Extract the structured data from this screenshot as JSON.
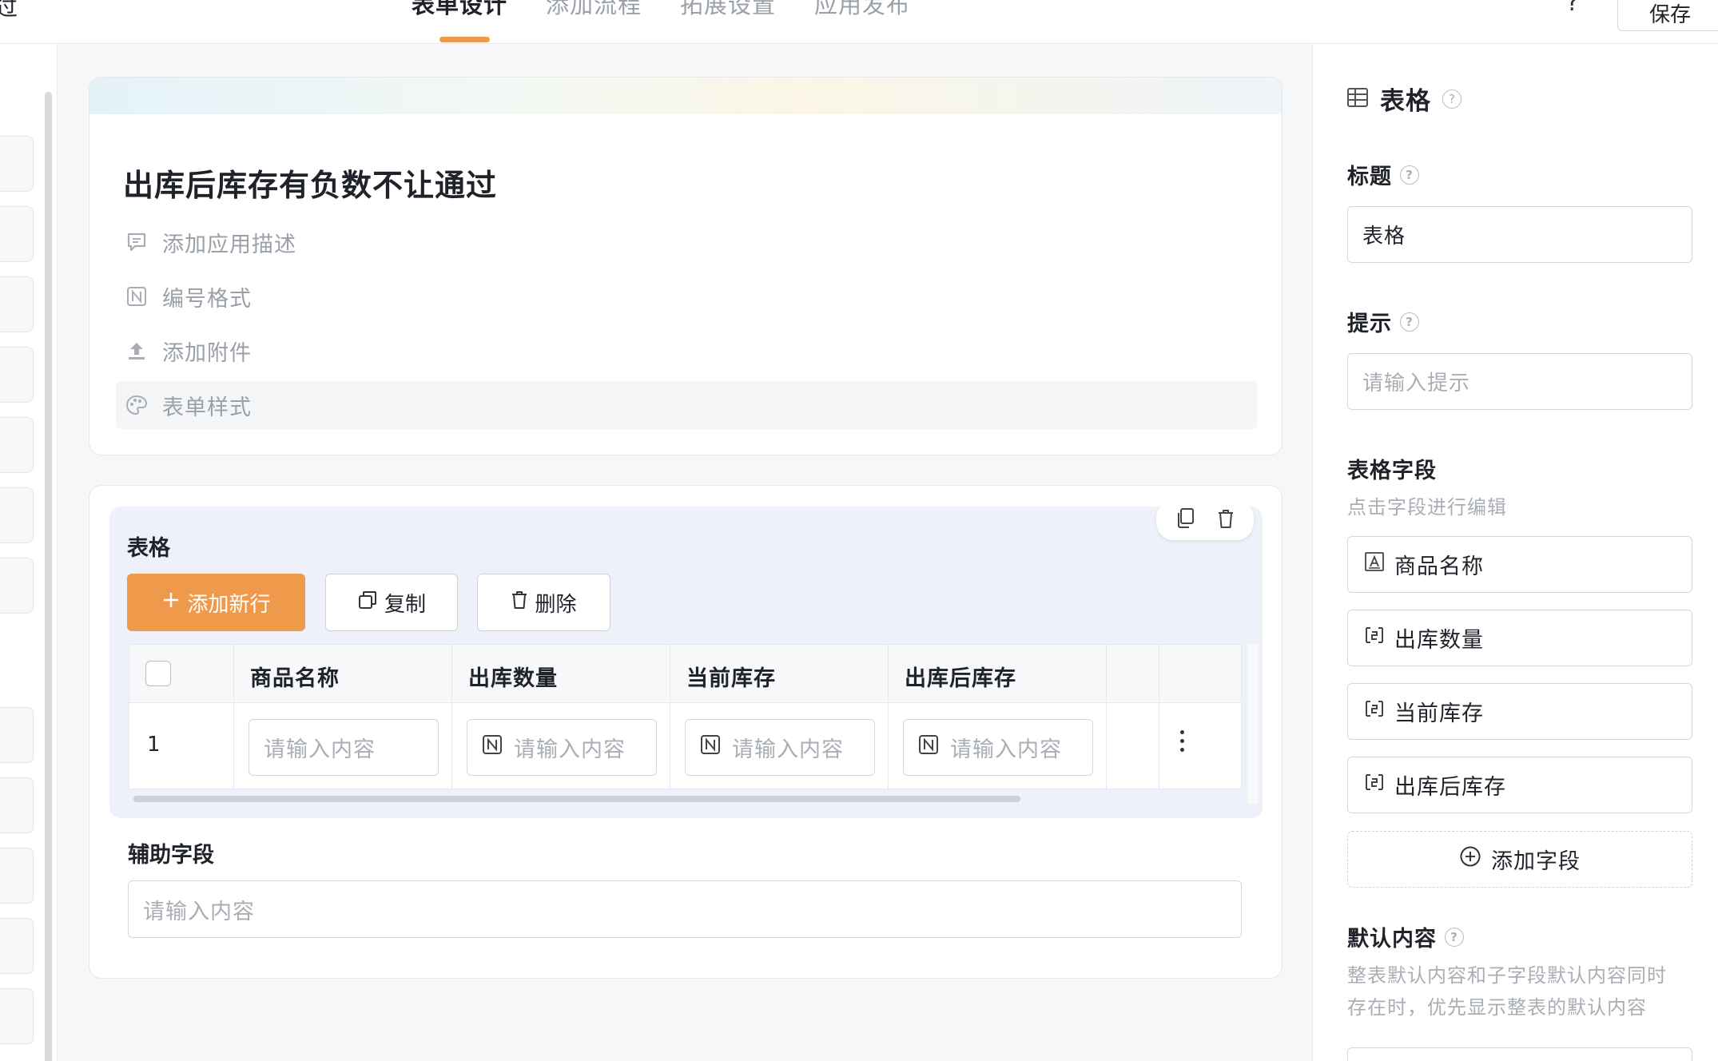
{
  "topbar": {
    "back_text": "过",
    "tabs": [
      {
        "label": "表单设计",
        "active": true
      },
      {
        "label": "添加流程",
        "active": false
      },
      {
        "label": "拓展设置",
        "active": false
      },
      {
        "label": "应用发布",
        "active": false
      }
    ],
    "help": "?",
    "save_label": "保存"
  },
  "form_header": {
    "title": "出库后库存有负数不让通过",
    "options": [
      {
        "label": "添加应用描述",
        "icon": "comment-icon"
      },
      {
        "label": "编号格式",
        "icon": "number-icon"
      },
      {
        "label": "添加附件",
        "icon": "upload-icon"
      },
      {
        "label": "表单样式",
        "icon": "palette-icon"
      }
    ]
  },
  "table_block": {
    "title": "表格",
    "add_row_label": "添加新行",
    "copy_label": "复制",
    "delete_label": "删除",
    "columns": [
      "商品名称",
      "出库数量",
      "当前库存",
      "出库后库存"
    ],
    "rows": [
      {
        "index": "1",
        "placeholders": [
          "请输入内容",
          "请输入内容",
          "请输入内容",
          "请输入内容"
        ]
      }
    ]
  },
  "aux_field": {
    "label": "辅助字段",
    "placeholder": "请输入内容"
  },
  "panel": {
    "title": "表格",
    "title_label": "标题",
    "title_value": "表格",
    "tip_label": "提示",
    "tip_placeholder": "请输入提示",
    "fields_label": "表格字段",
    "fields_hint": "点击字段进行编辑",
    "fields": [
      {
        "label": "商品名称",
        "icon": "text-field-icon"
      },
      {
        "label": "出库数量",
        "icon": "number-field-icon"
      },
      {
        "label": "当前库存",
        "icon": "number-field-icon"
      },
      {
        "label": "出库后库存",
        "icon": "number-field-icon"
      }
    ],
    "add_field_label": "添加字段",
    "default_label": "默认内容",
    "default_hint_1": "整表默认内容和子字段默认内容同时",
    "default_hint_2": "存在时，优先显示整表的默认内容"
  },
  "colors": {
    "accent": "#ef9a4b",
    "block_bg": "#eef1fa",
    "placeholder": "#a9aeb5"
  }
}
